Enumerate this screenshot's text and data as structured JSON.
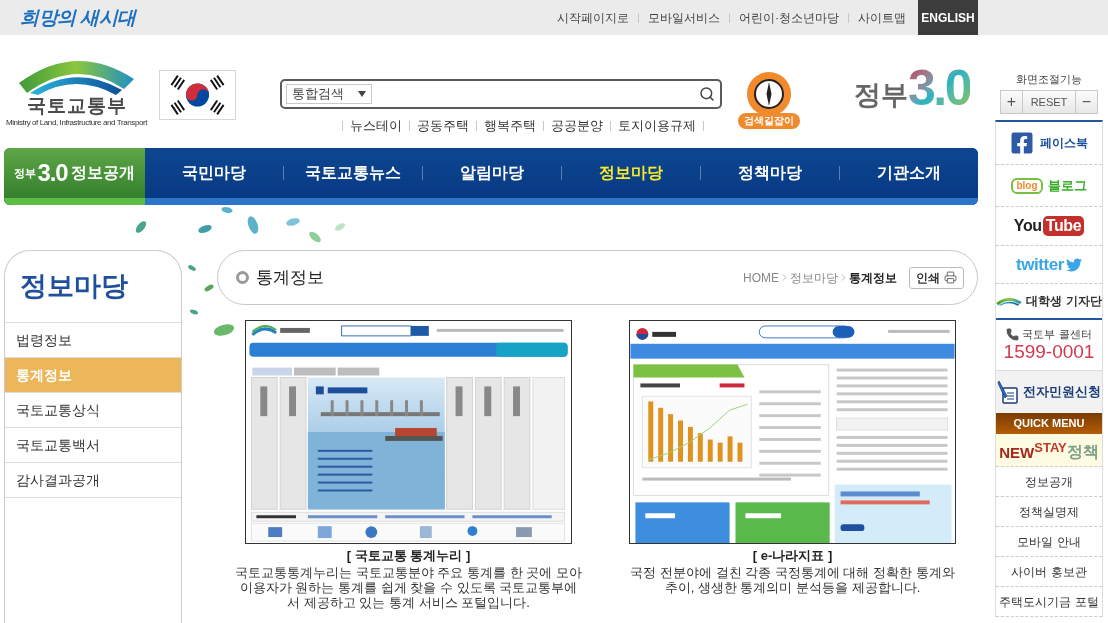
{
  "top_bar": {
    "slogan": "희망의 새시대",
    "links": [
      "시작페이지로",
      "모바일서비스",
      "어린이·청소년마당",
      "사이트맵"
    ],
    "language_button": "ENGLISH"
  },
  "header": {
    "logo": {
      "name": "국토교통부",
      "subtitle": "Ministry of Land, Infrastructure and Transport"
    },
    "search": {
      "scope": "통합검색"
    },
    "quick_links": [
      "뉴스테이",
      "공동주택",
      "행복주택",
      "공공분양",
      "토지이용규제"
    ],
    "search_guide": "검색길잡이",
    "gov_logo": {
      "text": "정부",
      "version": "3.0"
    }
  },
  "font_control": {
    "title": "화면조절기능",
    "buttons": [
      "+",
      "RESET",
      "−"
    ]
  },
  "nav": {
    "badge": {
      "prefix": "정부",
      "version": "3.0",
      "label": "정보공개"
    },
    "items": [
      {
        "label": "국민마당",
        "selected": false
      },
      {
        "label": "국토교통뉴스",
        "selected": false
      },
      {
        "label": "알림마당",
        "selected": false
      },
      {
        "label": "정보마당",
        "selected": true
      },
      {
        "label": "정책마당",
        "selected": false
      },
      {
        "label": "기관소개",
        "selected": false
      }
    ]
  },
  "sidebar": {
    "title": "정보마당",
    "items": [
      {
        "label": "법령정보",
        "selected": false
      },
      {
        "label": "통계정보",
        "selected": true
      },
      {
        "label": "국토교통상식",
        "selected": false
      },
      {
        "label": "국토교통백서",
        "selected": false
      },
      {
        "label": "감사결과공개",
        "selected": false
      }
    ]
  },
  "content": {
    "title": "통계정보",
    "breadcrumb": [
      "HOME",
      "정보마당",
      "통계정보"
    ],
    "print_button": "인쇄",
    "cards": [
      {
        "kind": "stats_portal",
        "title": "[ 국토교통 통계누리 ]",
        "description_lines": [
          "국토교통통계누리는 국토교통분야 주요 통계를 한 곳에 모아",
          "이용자가 원하는 통계를 쉽게 찾을 수 있도록 국토교통부에",
          "서 제공하고 있는 통계 서비스 포털입니다."
        ]
      },
      {
        "kind": "indicators_portal",
        "title": "[ e-나라지표 ]",
        "description_lines": [
          "국정 전분야에 걸친 각종 국정통계에 대해 정확한 통계와",
          "추이, 생생한 통계의미 분석등을 제공합니다."
        ]
      }
    ]
  },
  "quick_sidebar": {
    "social": [
      {
        "kind": "facebook",
        "label": "페이스북"
      },
      {
        "kind": "blog",
        "badge": "blog",
        "label": "블로그"
      },
      {
        "kind": "youtube",
        "label": "You",
        "badge": "Tube"
      },
      {
        "kind": "twitter",
        "label": "twitter"
      },
      {
        "kind": "reporters",
        "label": "대학생 기자단"
      }
    ],
    "call_center": {
      "label": "국토부 콜센터",
      "phone": "1599-0001"
    },
    "petition": "전자민원신청",
    "quick_menu": {
      "title": "QUICK MENU",
      "banner": {
        "new": "NEW",
        "stay": "STAY",
        "policy": "정책"
      },
      "items": [
        "정보공개",
        "정책실명제",
        "모바일 안내",
        "사이버 홍보관",
        "주택도시기금 포털"
      ]
    }
  }
}
